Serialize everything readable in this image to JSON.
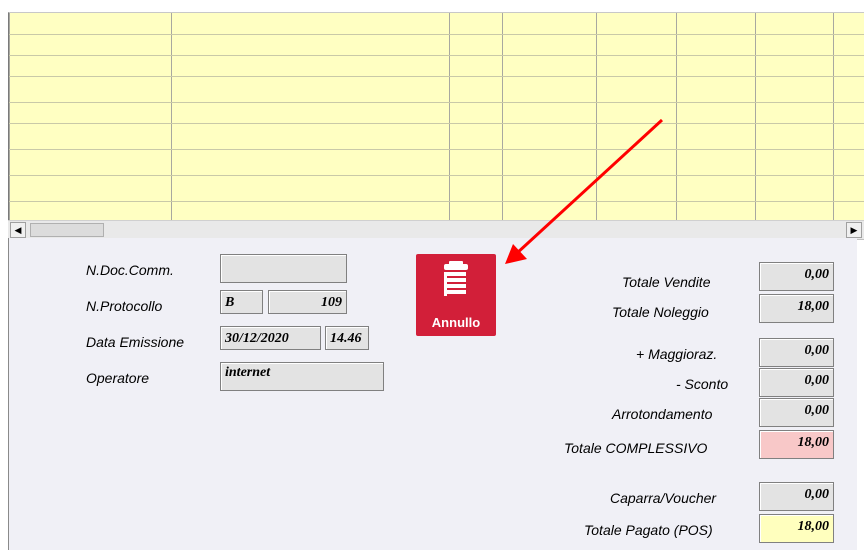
{
  "left_fields": {
    "ndoc_label": "N.Doc.Comm.",
    "ndoc_value": "",
    "nprot_label": "N.Protocollo",
    "nprot_series": "B",
    "nprot_number": "109",
    "data_label": "Data Emissione",
    "data_date": "30/12/2020",
    "data_time": "14.46",
    "operatore_label": "Operatore",
    "operatore_value": "internet"
  },
  "annullo_button": {
    "label": "Annullo",
    "icon": "trash-icon",
    "color": "#d21f39"
  },
  "totals": {
    "vendite_label": "Totale Vendite",
    "vendite_value": "0,00",
    "noleggio_label": "Totale Noleggio",
    "noleggio_value": "18,00",
    "maggioraz_label": "+ Maggioraz.",
    "maggioraz_value": "0,00",
    "sconto_label": "- Sconto",
    "sconto_value": "0,00",
    "arrotondamento_label": "Arrotondamento",
    "arrotondamento_value": "0,00",
    "complessivo_label": "Totale COMPLESSIVO",
    "complessivo_value": "18,00",
    "caparra_label": "Caparra/Voucher",
    "caparra_value": "0,00",
    "pagato_label": "Totale Pagato (POS)",
    "pagato_value": "18,00"
  },
  "colors": {
    "grid_background": "#ffffc2",
    "complessivo_highlight": "#f8c8c8",
    "pagato_highlight": "#ffffbe",
    "annotation_arrow": "#ff0000"
  }
}
